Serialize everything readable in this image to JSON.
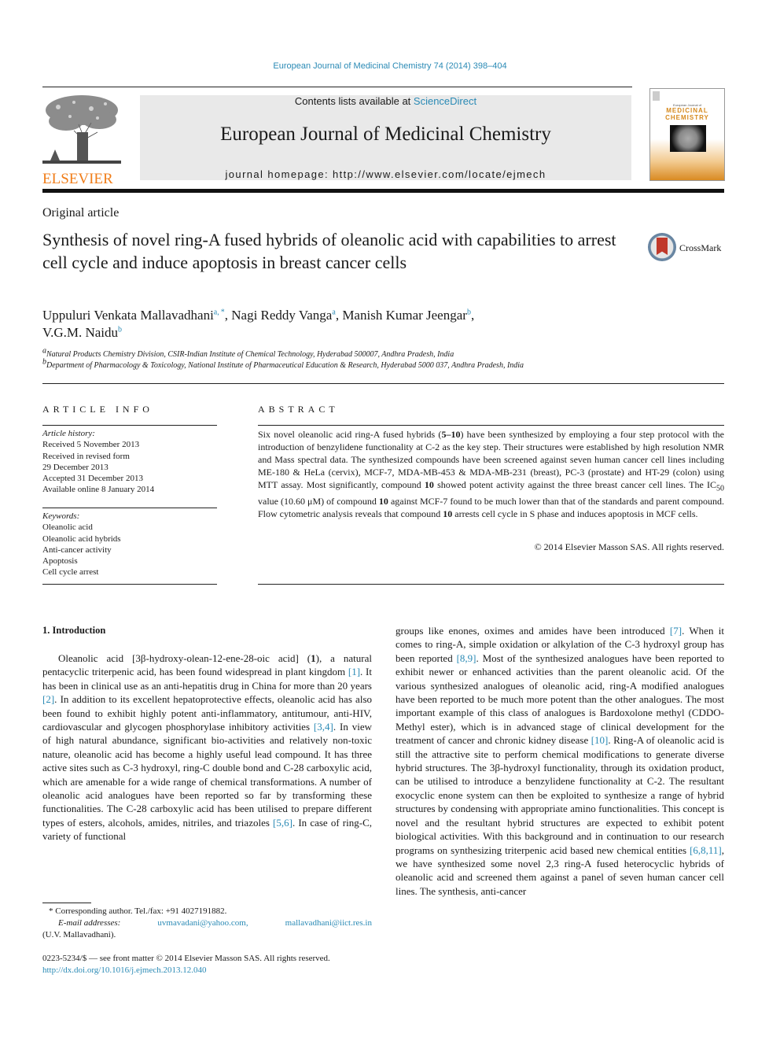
{
  "citation": "European Journal of Medicinal Chemistry 74 (2014) 398–404",
  "header": {
    "publisher_logo": "ELSEVIER",
    "contents_prefix": "Contents lists available at ",
    "contents_link": "ScienceDirect",
    "journal_name": "European Journal of Medicinal Chemistry",
    "homepage": "journal homepage: http://www.elsevier.com/locate/ejmech",
    "cover": {
      "line1": "European Journal of",
      "line2": "MEDICINAL",
      "line3": "CHEMISTRY"
    }
  },
  "article_type": "Original article",
  "title": "Synthesis of novel ring-A fused hybrids of oleanolic acid with capabilities to arrest cell cycle and induce apoptosis in breast cancer cells",
  "crossmark_label": "CrossMark",
  "authors": [
    {
      "name": "Uppuluri Venkata Mallavadhani",
      "sup": "a, *",
      "sep": ", "
    },
    {
      "name": "Nagi Reddy Vanga",
      "sup": "a",
      "sep": ", "
    },
    {
      "name": "Manish Kumar Jeengar",
      "sup": "b",
      "sep": ","
    },
    {
      "name": "V.G.M. Naidu",
      "sup": "b",
      "sep": ""
    }
  ],
  "affiliations": [
    {
      "mark": "a",
      "text": "Natural Products Chemistry Division, CSIR-Indian Institute of Chemical Technology, Hyderabad 500007, Andhra Pradesh, India"
    },
    {
      "mark": "b",
      "text": "Department of Pharmacology & Toxicology, National Institute of Pharmaceutical Education & Research, Hyderabad 5000 037, Andhra Pradesh, India"
    }
  ],
  "article_info": {
    "heading": "ARTICLE INFO",
    "history_label": "Article history:",
    "history": [
      "Received 5 November 2013",
      "Received in revised form",
      "29 December 2013",
      "Accepted 31 December 2013",
      "Available online 8 January 2014"
    ],
    "keywords_label": "Keywords:",
    "keywords": [
      "Oleanolic acid",
      "Oleanolic acid hybrids",
      "Anti-cancer activity",
      "Apoptosis",
      "Cell cycle arrest"
    ]
  },
  "abstract": {
    "heading": "ABSTRACT",
    "parts": [
      {
        "t": "Six novel oleanolic acid ring-A fused hybrids ("
      },
      {
        "t": "5–10",
        "b": true
      },
      {
        "t": ") have been synthesized by employing a four step protocol with the introduction of benzylidene functionality at C-2 as the key step. Their structures were established by high resolution NMR and Mass spectral data. The synthesized compounds have been screened against seven human cancer cell lines including ME-180 & HeLa (cervix), MCF-7, MDA-MB-453 & MDA-MB-231 (breast), PC-3 (prostate) and HT-29 (colon) using MTT assay. Most significantly, compound "
      },
      {
        "t": "10",
        "b": true
      },
      {
        "t": " showed potent activity against the three breast cancer cell lines. The IC"
      },
      {
        "t": "50",
        "sub": true
      },
      {
        "t": " value (10.60 μM) of compound "
      },
      {
        "t": "10",
        "b": true
      },
      {
        "t": " against MCF-7 found to be much lower than that of the standards and parent compound. Flow cytometric analysis reveals that compound "
      },
      {
        "t": "10",
        "b": true
      },
      {
        "t": " arrests cell cycle in S phase and induces apoptosis in MCF cells."
      }
    ],
    "copyright": "© 2014 Elsevier Masson SAS. All rights reserved."
  },
  "introduction": {
    "heading": "1.  Introduction",
    "col1": [
      {
        "t": "Oleanolic acid [3β-hydroxy-olean-12-ene-28-oic acid] ("
      },
      {
        "t": "1",
        "b": true
      },
      {
        "t": "), a natural pentacyclic triterpenic acid, has been found widespread in plant kingdom "
      },
      {
        "t": "[1]",
        "link": true
      },
      {
        "t": ". It has been in clinical use as an anti-hepatitis drug in China for more than 20 years "
      },
      {
        "t": "[2]",
        "link": true
      },
      {
        "t": ". In addition to its excellent hepatoprotective effects, oleanolic acid has also been found to exhibit highly potent anti-inflammatory, antitumour, anti-HIV, cardiovascular and glycogen phosphorylase inhibitory activities "
      },
      {
        "t": "[3,4]",
        "link": true
      },
      {
        "t": ". In view of high natural abundance, significant bio-activities and relatively non-toxic nature, oleanolic acid has become a highly useful lead compound. It has three active sites such as C-3 hydroxyl, ring-C double bond and C-28 carboxylic acid, which are amenable for a wide range of chemical transformations. A number of oleanolic acid analogues have been reported so far by transforming these functionalities. The C-28 carboxylic acid has been utilised to prepare different types of esters, alcohols, amides, nitriles, and triazoles "
      },
      {
        "t": "[5,6]",
        "link": true
      },
      {
        "t": ". In case of ring-C, variety of functional"
      }
    ],
    "col2": [
      {
        "t": "groups like enones, oximes and amides have been introduced "
      },
      {
        "t": "[7]",
        "link": true
      },
      {
        "t": ". When it comes to ring-A, simple oxidation or alkylation of the C-3 hydroxyl group has been reported "
      },
      {
        "t": "[8,9]",
        "link": true
      },
      {
        "t": ". Most of the synthesized analogues have been reported to exhibit newer or enhanced activities than the parent oleanolic acid. Of the various synthesized analogues of oleanolic acid, ring-A modified analogues have been reported to be much more potent than the other analogues. The most important example of this class of analogues is Bardoxolone methyl (CDDO-Methyl ester), which is in advanced stage of clinical development for the treatment of cancer and chronic kidney disease "
      },
      {
        "t": "[10]",
        "link": true
      },
      {
        "t": ". Ring-A of oleanolic acid is still the attractive site to perform chemical modifications to generate diverse hybrid structures. The 3β-hydroxyl functionality, through its oxidation product, can be utilised to introduce a benzylidene functionality at C-2. The resultant exocyclic enone system can then be exploited to synthesize a range of hybrid structures by condensing with appropriate amino functionalities. This concept is novel and the resultant hybrid structures are expected to exhibit potent biological activities. With this background and in continuation to our research programs on synthesizing triterpenic acid based new chemical entities "
      },
      {
        "t": "[6,8,11]",
        "link": true
      },
      {
        "t": ", we have synthesized some novel 2,3 ring-A fused heterocyclic hybrids of oleanolic acid and screened them against a panel of seven human cancer cell lines. The synthesis, anti-cancer"
      }
    ]
  },
  "footnote": {
    "corresponding": "* Corresponding author. Tel./fax: +91 4027191882.",
    "email_label": "E-mail addresses:",
    "emails": [
      "uvmavadani@yahoo.com,",
      "mallavadhani@iict.res.in"
    ],
    "name": "(U.V. Mallavadhani)."
  },
  "front_matter": {
    "issn": "0223-5234/$ — see front matter © 2014 Elsevier Masson SAS. All rights reserved.",
    "doi": "http://dx.doi.org/10.1016/j.ejmech.2013.12.040"
  },
  "colors": {
    "link": "#2a8ab5",
    "elsevier_orange": "#f07d19",
    "banner_bg": "#e9e9e9"
  }
}
